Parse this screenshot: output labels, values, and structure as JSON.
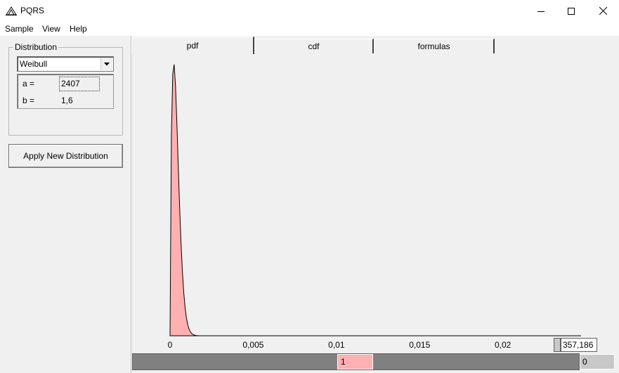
{
  "window": {
    "title": "PQRS"
  },
  "menu": {
    "items": [
      "Sample",
      "View",
      "Help"
    ]
  },
  "distribution": {
    "group_label": "Distribution",
    "selected": "Weibull",
    "params": [
      {
        "label": "a =",
        "value": "2407"
      },
      {
        "label": "b =",
        "value": "1,6"
      }
    ]
  },
  "apply_button": "Apply New Distribution",
  "tabs": [
    "pdf",
    "cdf",
    "formulas"
  ],
  "colors": {
    "fill": "#ffb0b0",
    "accent": "#ffb0b0"
  },
  "chart_data": {
    "type": "area",
    "title": "",
    "xlabel": "",
    "ylabel": "",
    "xlim": [
      0,
      0.0247
    ],
    "x_ticks": [
      "0",
      "0,005",
      "0,01",
      "0,015",
      "0,02"
    ],
    "x_tick_values": [
      0,
      0.005,
      0.01,
      0.015,
      0.02
    ],
    "distribution": "Weibull",
    "params": {
      "a": 2407,
      "b": 1.6
    },
    "grid": false
  },
  "bottom": {
    "cursor_value": "1",
    "right_value": "0",
    "xmax_value": "357,186"
  }
}
